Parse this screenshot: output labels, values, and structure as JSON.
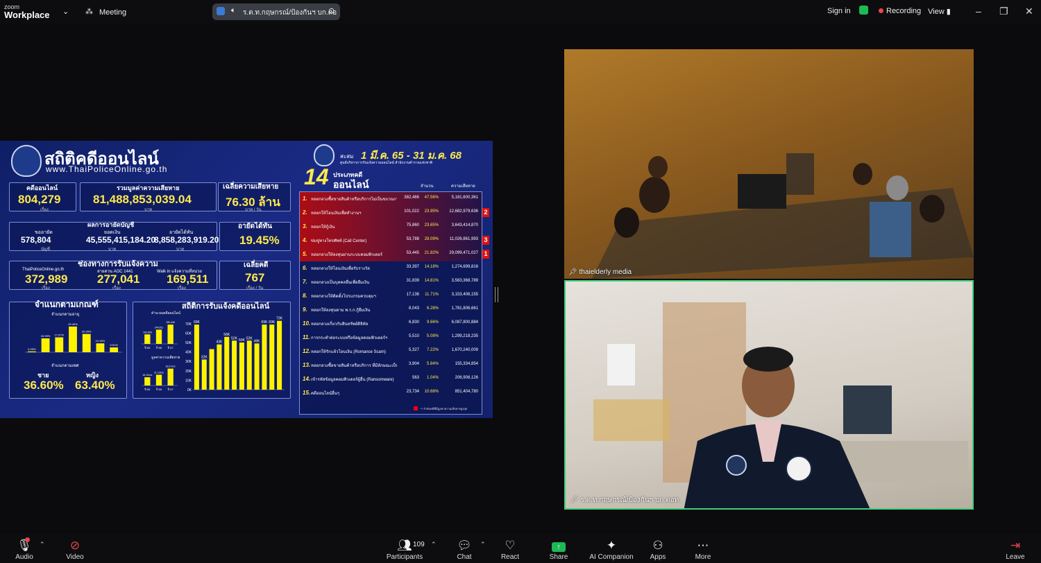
{
  "topbar": {
    "logo_top": "zoom",
    "logo_bottom": "Workplace",
    "meeting_label": "Meeting",
    "share_pill_text": "ร.ต.ท.กฤษกรณ์/ป้องกันฯ บก.ตอ",
    "sign_in": "Sign in",
    "recording": "Recording",
    "view": "View"
  },
  "slide": {
    "title": "สถิติคดีออนไลน์",
    "url": "www.ThaiPoliceOnline.go.th",
    "cases_label": "คดีออนไลน์",
    "cases_value": "804,279",
    "cases_unit": "เรื่อง",
    "damage_label": "รวมมูลค่าความเสียหาย",
    "damage_value": "81,488,853,039.04",
    "damage_unit": "บาท",
    "avg_damage_label": "เฉลี่ยความเสียหาย",
    "avg_damage_value": "76.30 ล้าน",
    "avg_damage_unit": "บาท / วัน",
    "freeze_label": "ผลการอายัดบัญชี",
    "freeze_req_label": "ขออายัด",
    "freeze_req_value": "578,804",
    "freeze_req_unit": "บัญชี",
    "freeze_amt_label": "ยอดเงิน",
    "freeze_amt_value": "45,555,415,184.20",
    "freeze_amt_unit": "บาท",
    "freeze_ok_label": "อายัดได้ทัน",
    "freeze_ok_value": "8,858,283,919.20",
    "freeze_ok_unit": "บาท",
    "freeze_rate_label": "อายัดได้ทัน",
    "freeze_rate_value": "19.45%",
    "channel_label": "ช่องทางการรับแจ้งความ",
    "ch1_label": "ThaiPoliceOnline.go.th",
    "ch1_value": "372,989",
    "ch2_label": "สายด่วน AOC 1441",
    "ch2_value": "277,041",
    "ch3_label": "Walk in แจ้งความที่หน่วย",
    "ch3_value": "169,511",
    "ch_unit": "เรื่อง",
    "avg_cases_label": "เฉลี่ยคดี",
    "avg_cases_value": "767",
    "avg_cases_unit": "เรื่อง / วัน",
    "classify_label": "จำแนกตามเกณฑ์",
    "age_label": "จำแนกตามอายุ",
    "gender_label": "จำแนกตามเพศ",
    "male_label": "ชาย",
    "male_value": "36.60%",
    "female_label": "หญิง",
    "female_value": "63.40%",
    "stats_label": "สถิติการรับแจ้งคดีออนไลน์",
    "stats_sub1": "คำนวณคดีออนไลน์",
    "stats_sub2": "มูลค่าความเสียหาย",
    "cum_label": "สะสม",
    "period": "1 มี.ค. 65 - 31 ม.ค. 68",
    "center_name": "ศูนย์บริหารการรับแจ้งความออนไลน์ สำนักงานตำรวจแห่งชาติ",
    "types_count": "14",
    "types_label1": "ประเภทคดี",
    "types_label2": "ออนไลน์",
    "col_count": "จำนวน",
    "col_damage": "ความเสียหาย",
    "footnote": "** ลำดับคดีที่มีมูลค่าความเสียหายสูงสุด",
    "rows": [
      {
        "n": "1.",
        "t": "หลอกลวงซื้อขายสินค้าหรือบริการไม่เป็นขบวนการ",
        "c": "382,486",
        "p": "47.56%",
        "v": "5,181,600,361",
        "r": ""
      },
      {
        "n": "2.",
        "t": "หลอกให้โอนเงินเพื่อทำงานฯ",
        "c": "101,022",
        "p": "23.95%",
        "v": "12,682,979,636",
        "r": "2"
      },
      {
        "n": "3.",
        "t": "หลอกให้กู้เงิน",
        "c": "75,860",
        "p": "23.65%",
        "v": "3,643,414,870",
        "r": ""
      },
      {
        "n": "4.",
        "t": "ข่มขู่ทางโทรศัพท์ (Call Center)",
        "c": "53,788",
        "p": "28.09%",
        "v": "11,026,861,993",
        "r": "3"
      },
      {
        "n": "5.",
        "t": "หลอกลวงให้ลงทุนผ่านระบบคอมพิวเตอร์",
        "c": "53,445",
        "p": "21.82%",
        "v": "29,099,471,027",
        "r": "1"
      },
      {
        "n": "6.",
        "t": "หลอกลวงให้โอนเงินเพื่อรับรางวัล",
        "c": "33,397",
        "p": "14.18%",
        "v": "1,274,699,816",
        "r": ""
      },
      {
        "n": "7.",
        "t": "หลอกลวงเป็นบุคคลอื่นเพื่อยืมเงิน",
        "c": "31,839",
        "p": "14.81%",
        "v": "3,563,368,789",
        "r": ""
      },
      {
        "n": "8.",
        "t": "หลอกลวงให้ติดตั้งโปรแกรมควบคุมฯ",
        "c": "17,136",
        "p": "11.71%",
        "v": "3,153,406,155",
        "r": ""
      },
      {
        "n": "9.",
        "t": "หลอกให้ลงทุนตาม พ.ร.ก.กู้ยืมเงิน",
        "c": "8,043",
        "p": "6.28%",
        "v": "1,781,806,661",
        "r": ""
      },
      {
        "n": "10.",
        "t": "หลอกลวงเกี่ยวกับสินทรัพย์ดิจิทัล",
        "c": "6,830",
        "p": "9.66%",
        "v": "6,087,800,884",
        "r": ""
      },
      {
        "n": "11.",
        "t": "การกระทำต่อระบบหรือข้อมูลคอมพิวเตอร์ฯ",
        "c": "5,510",
        "p": "5.08%",
        "v": "1,299,218,235",
        "r": ""
      },
      {
        "n": "12.",
        "t": "หลอกให้รักแล้วโอนเงิน (Romance Scam)",
        "c": "5,327",
        "p": "7.22%",
        "v": "1,670,240,009",
        "r": ""
      },
      {
        "n": "13.",
        "t": "หลอกลวงซื้อขายสินค้าหรือบริการ ที่มีลักษณะเป็นขบวนการ",
        "c": "3,904",
        "p": "5.84%",
        "v": "155,334,854",
        "r": ""
      },
      {
        "n": "14.",
        "t": "เข้ารหัสข้อมูลคอมพิวเตอร์ผู้อื่น (Ransomware)",
        "c": "563",
        "p": "1.04%",
        "v": "206,906,126",
        "r": ""
      },
      {
        "n": "15.",
        "t": "คดีออนไลน์อื่นๆ",
        "c": "23,734",
        "p": "10.68%",
        "v": "851,404,780",
        "r": ""
      }
    ]
  },
  "chart_data": [
    {
      "type": "bar",
      "title": "จำแนกตามอายุ",
      "values_pct": [
        0.95,
        15.9,
        17.07,
        29.46,
        20.95,
        10.16,
        5.51
      ],
      "labels": [
        "0.95%",
        "15.90%",
        "17.07%",
        "29.46%",
        "20.95%",
        "10.16%",
        "5.51%"
      ],
      "ylim": [
        0,
        35
      ]
    },
    {
      "type": "bar",
      "title": "สถิติการรับแจ้งคดีออนไลน์",
      "values": [
        69,
        32,
        43,
        48,
        56,
        52,
        50,
        52,
        49,
        69,
        69,
        73
      ],
      "labels": [
        "69K",
        "32K",
        "",
        "43K",
        "56K",
        "52K",
        "50K",
        "52K",
        "49K",
        "69K",
        "69K",
        "73K"
      ],
      "y_ticks": [
        "0K",
        "10K",
        "20K",
        "30K",
        "40K",
        "50K",
        "60K",
        "70K"
      ],
      "ylim": [
        0,
        75
      ]
    },
    {
      "type": "bar",
      "title": "คำนวณคดีออนไลน์",
      "values": [
        163,
        244,
        330
      ],
      "labels": [
        "163,659",
        "244,511",
        "330,440"
      ],
      "categories": [
        "ปี 65",
        "ปี 66",
        "ปี 67"
      ]
    },
    {
      "type": "bar",
      "title": "มูลค่าความเสียหาย",
      "values": [
        16.19,
        21.13,
        33.17
      ],
      "labels": [
        "16,19xxx",
        "21,13xxx",
        "33,17xxx"
      ],
      "categories": [
        "ปี 65",
        "ปี 66",
        "ปี 67"
      ]
    }
  ],
  "videos": [
    {
      "name": "thaielderly media"
    },
    {
      "name": "ร.ต.ท.กฤษกรณ์/ป้องกันฯ บก.ตอท."
    }
  ],
  "toolbar": {
    "audio": "Audio",
    "video": "Video",
    "participants": "Participants",
    "participants_count": "109",
    "chat": "Chat",
    "react": "React",
    "share": "Share",
    "ai": "AI Companion",
    "apps": "Apps",
    "more": "More",
    "leave": "Leave"
  }
}
